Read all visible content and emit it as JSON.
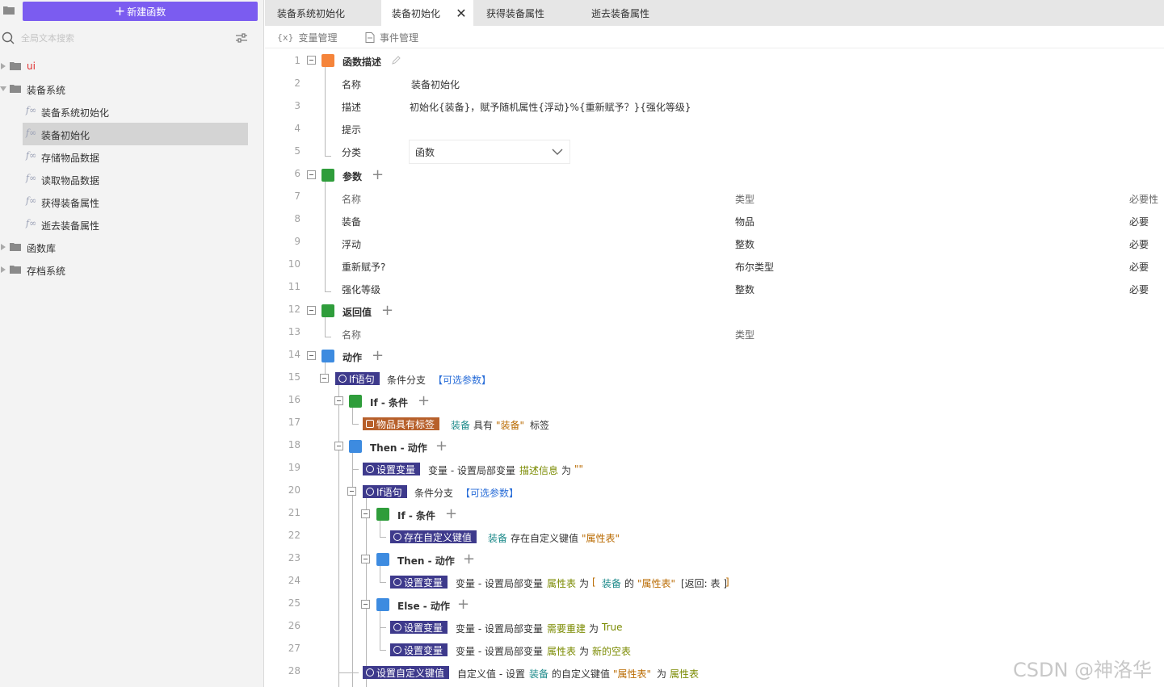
{
  "sidebar": {
    "new_function_label": "新建函数",
    "search_placeholder": "全局文本搜索",
    "tree": [
      {
        "label": "ui",
        "type": "folder",
        "color": "#e03030"
      },
      {
        "label": "装备系统",
        "type": "folder",
        "expanded": true
      },
      {
        "label": "装备系统初始化",
        "type": "function"
      },
      {
        "label": "装备初始化",
        "type": "function",
        "selected": true
      },
      {
        "label": "存储物品数据",
        "type": "function"
      },
      {
        "label": "读取物品数据",
        "type": "function"
      },
      {
        "label": "获得装备属性",
        "type": "function"
      },
      {
        "label": "逝去装备属性",
        "type": "function"
      },
      {
        "label": "函数库",
        "type": "folder"
      },
      {
        "label": "存档系统",
        "type": "folder"
      }
    ]
  },
  "tabs": [
    {
      "label": "装备系统初始化"
    },
    {
      "label": "装备初始化",
      "active": true
    },
    {
      "label": "获得装备属性"
    },
    {
      "label": "逝去装备属性"
    }
  ],
  "toolbar": {
    "variables_label": "变量管理",
    "variables_icon": "{x}",
    "events_label": "事件管理"
  },
  "editor": {
    "line_numbers": [
      "1",
      "2",
      "3",
      "4",
      "5",
      "6",
      "7",
      "8",
      "9",
      "10",
      "11",
      "12",
      "13",
      "14",
      "15",
      "16",
      "17",
      "18",
      "19",
      "20",
      "21",
      "22",
      "23",
      "24",
      "25",
      "26",
      "27",
      "28"
    ],
    "func_desc": "函数描述",
    "name_label": "名称",
    "name_value": "装备初始化",
    "desc_label": "描述",
    "desc_value": "初始化{装备}，赋予随机属性{浮动}%{重新赋予？}{强化等级}",
    "hint_label": "提示",
    "category_label": "分类",
    "category_value": "函数",
    "params_label": "参数",
    "params_header": {
      "name": "名称",
      "type": "类型",
      "required": "必要性"
    },
    "params": [
      {
        "name": "装备",
        "type": "物品",
        "required": "必要"
      },
      {
        "name": "浮动",
        "type": "整数",
        "required": "必要"
      },
      {
        "name": "重新赋予?",
        "type": "布尔类型",
        "required": "必要"
      },
      {
        "name": "强化等级",
        "type": "整数",
        "required": "必要"
      }
    ],
    "return_label": "返回值",
    "return_header": {
      "name": "名称",
      "type": "类型"
    },
    "actions_label": "动作",
    "if_stmt": "If语句",
    "cond_branch": "条件分支",
    "optional_params": "【可选参数】",
    "if_cond": "If - 条件",
    "then_action": "Then - 动作",
    "else_action": "Else - 动作",
    "item_has_tag": "物品具有标签",
    "equip": "装备",
    "has": "具有",
    "tag_value": "\"装备\"",
    "tag": "标签",
    "set_var": "设置变量",
    "var_set_local": "变量 - 设置局部变量",
    "desc_info": "描述信息",
    "to": "为",
    "empty_str": "\"\"",
    "has_custom_key": "存在自定义键值",
    "has_custom_key_text": "存在自定义键值",
    "attr_table_str": "\"属性表\"",
    "attr_table": "属性表",
    "bracket_open": "[",
    "of": "的",
    "return_table": "[返回: 表 ]",
    "bracket_close": "]",
    "need_rebuild": "需要重建",
    "true_val": "True",
    "new_empty_table": "新的空表",
    "set_custom_key": "设置自定义键值",
    "custom_value_set": "自定义值 - 设置",
    "custom_key_of": "的自定义键值"
  },
  "watermark": "CSDN @神洛华",
  "colors": {
    "accent": "#7b5cf0",
    "chip": "#3e3a8c",
    "chip_tag": "#b7602b",
    "teal": "#1d8a8a",
    "olive": "#7a8a00",
    "string": "#b96a00"
  }
}
